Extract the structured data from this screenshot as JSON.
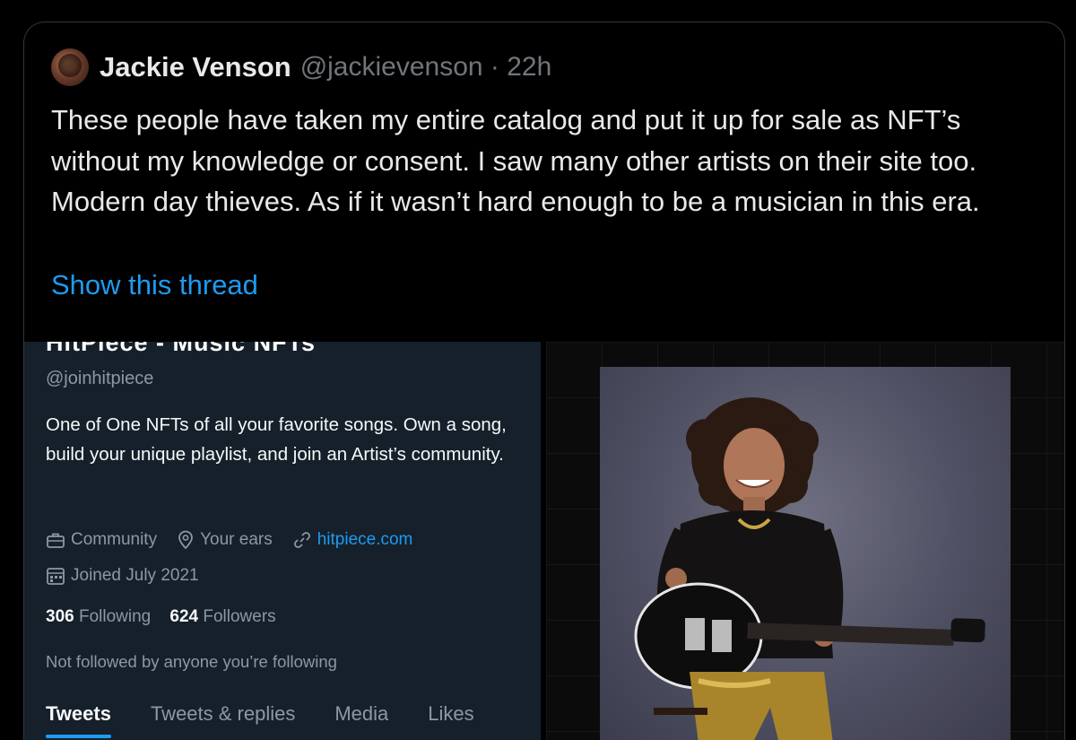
{
  "tweet": {
    "display_name": "Jackie Venson",
    "handle_meta": "@jackievenson · 22h",
    "text": "These people have taken my entire catalog and put it up for sale as NFT’s without my knowledge or consent. I saw many other artists on their site too. Modern day thieves. As if it wasn’t hard enough to be a musician in this era.",
    "show_thread": "Show this thread"
  },
  "profile_screenshot": {
    "name": "HitPiece - Music NFTs",
    "handle": "@joinhitpiece",
    "bio": "One of One NFTs of all your favorite songs. Own a song, build your unique playlist, and join an Artist’s community.",
    "category": "Community",
    "location": "Your ears",
    "website": "hitpiece.com",
    "joined": "Joined July 2021",
    "following_count": "306",
    "following_label": "Following",
    "followers_count": "624",
    "followers_label": "Followers",
    "not_followed": "Not followed by anyone you’re following",
    "tabs": [
      "Tweets",
      "Tweets & replies",
      "Media",
      "Likes"
    ]
  },
  "colors": {
    "background": "#000000",
    "link": "#1d9bf0",
    "muted": "#71767b",
    "profile_bg": "#15202b"
  }
}
